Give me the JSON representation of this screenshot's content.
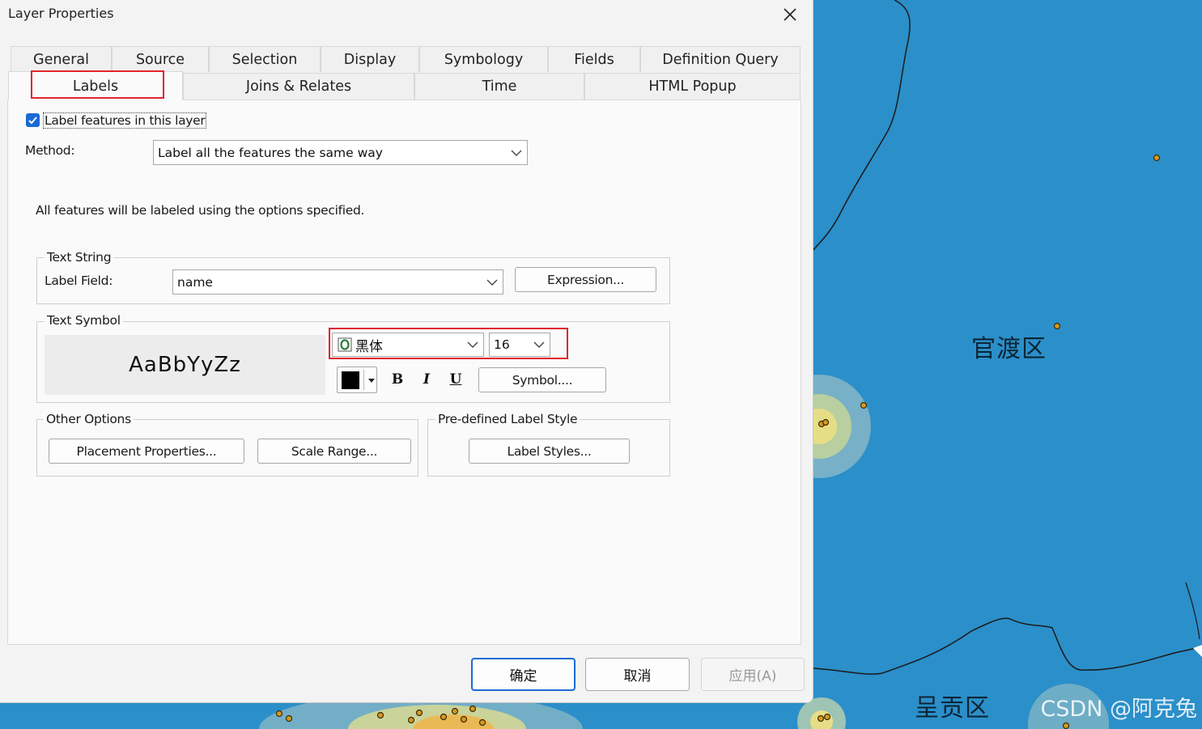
{
  "window": {
    "title": "Layer Properties"
  },
  "tabs": {
    "row1": [
      "General",
      "Source",
      "Selection",
      "Display",
      "Symbology",
      "Fields",
      "Definition Query"
    ],
    "row2": [
      "Labels",
      "Joins & Relates",
      "Time",
      "HTML Popup"
    ],
    "active": "Labels"
  },
  "labels_tab": {
    "label_features": {
      "text": "Label features in this layer",
      "checked": true
    },
    "method": {
      "label": "Method:",
      "value": "Label all the features the same way"
    },
    "info_text": "All features will be labeled using the options specified.",
    "text_string": {
      "title": "Text String",
      "label_field_label": "Label Field:",
      "label_field_value": "name",
      "expression_button": "Expression..."
    },
    "text_symbol": {
      "title": "Text Symbol",
      "preview_text": "AaBbYyZz",
      "font": "黑体",
      "size": "16",
      "color": "#000000",
      "bold": "B",
      "italic": "I",
      "underline": "U",
      "symbol_button": "Symbol...."
    },
    "other_options": {
      "title": "Other Options",
      "placement_button": "Placement Properties...",
      "scale_button": "Scale Range..."
    },
    "predefined": {
      "title": "Pre-defined Label Style",
      "label_styles_button": "Label Styles..."
    }
  },
  "footer": {
    "ok": "确定",
    "cancel": "取消",
    "apply": "应用(A)"
  },
  "map": {
    "labels": [
      "官渡区",
      "呈贡区"
    ],
    "watermark": "CSDN @阿克兔",
    "water_color": "#2b8fc9"
  }
}
